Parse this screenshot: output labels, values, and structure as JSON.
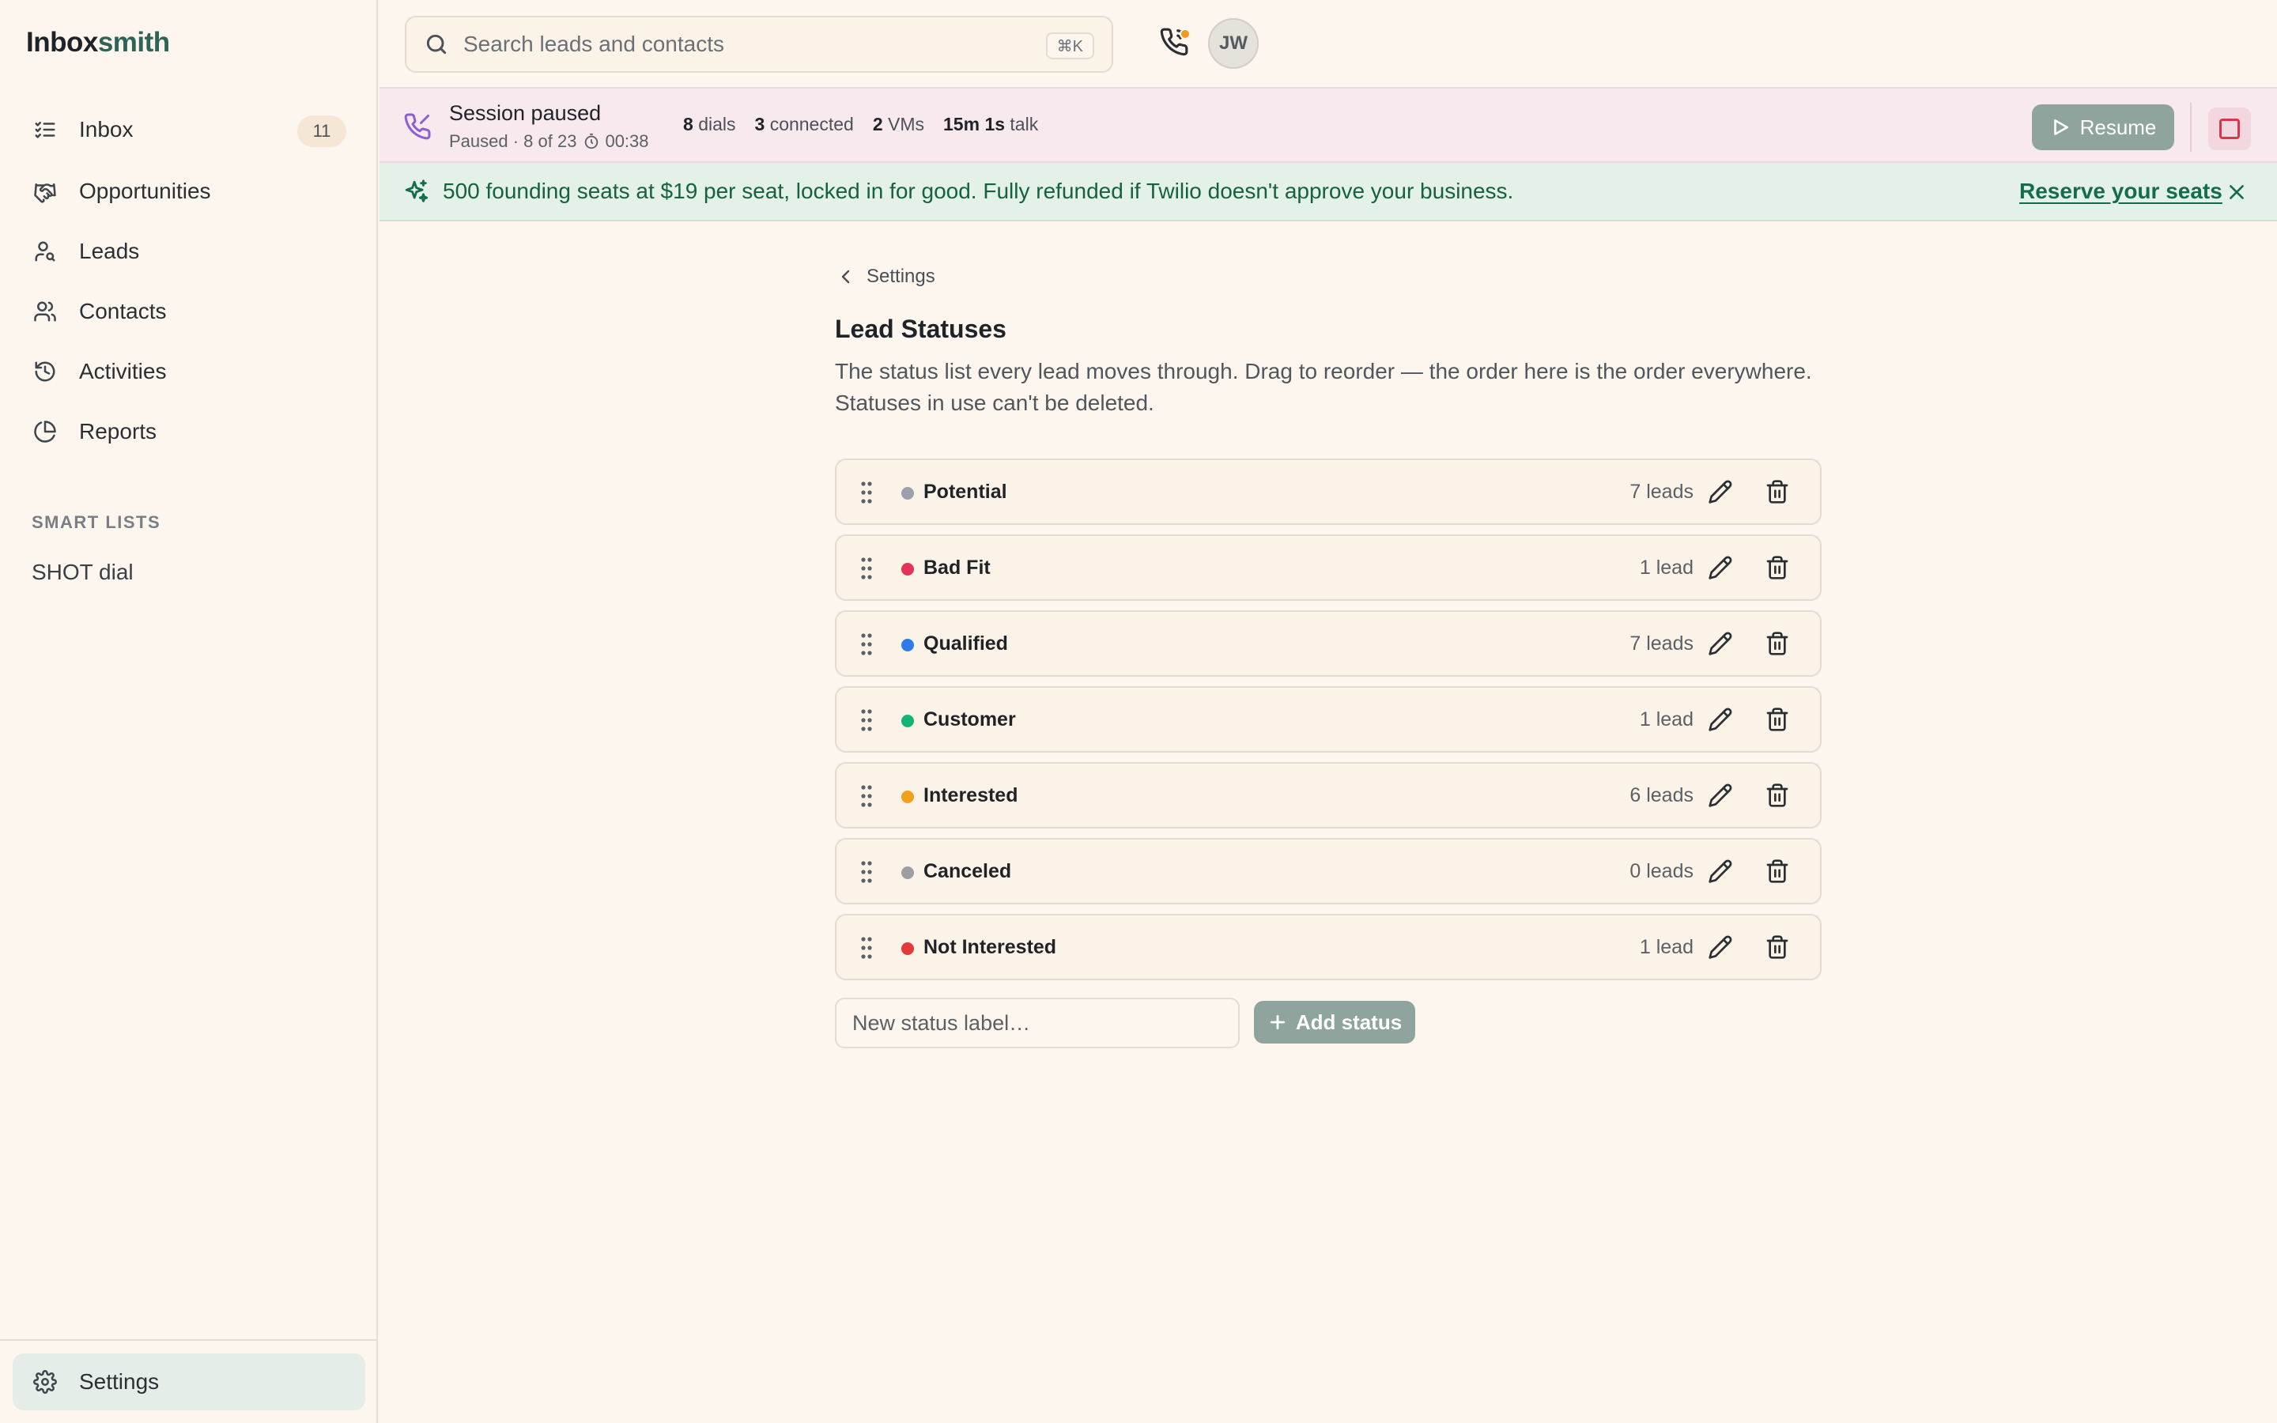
{
  "app": {
    "brand_part1": "Inbox",
    "brand_part2": "smith"
  },
  "sidebar": {
    "items": [
      {
        "label": "Inbox",
        "icon": "list-check-icon",
        "badge": "11"
      },
      {
        "label": "Opportunities",
        "icon": "handshake-icon"
      },
      {
        "label": "Leads",
        "icon": "user-search-icon"
      },
      {
        "label": "Contacts",
        "icon": "users-icon"
      },
      {
        "label": "Activities",
        "icon": "history-icon"
      },
      {
        "label": "Reports",
        "icon": "pie-chart-icon"
      }
    ],
    "section_label": "SMART LISTS",
    "smart_lists": [
      "SHOT dial"
    ],
    "settings_label": "Settings"
  },
  "topbar": {
    "search_placeholder": "Search leads and contacts",
    "search_shortcut": "⌘K",
    "avatar_initials": "JW",
    "notification_dot_color": "#f29a1f"
  },
  "session": {
    "title": "Session paused",
    "subtitle": "Paused · 8 of 23",
    "timer": "00:38",
    "stats": [
      {
        "value": "8",
        "label": "dials"
      },
      {
        "value": "3",
        "label": "connected"
      },
      {
        "value": "2",
        "label": "VMs"
      },
      {
        "value": "15m 1s",
        "label": "talk"
      }
    ],
    "resume_label": "Resume"
  },
  "promo": {
    "text": "500 founding seats at $19 per seat, locked in for good. Fully refunded if Twilio doesn't approve your business.",
    "link_label": "Reserve your seats"
  },
  "main": {
    "back_label": "Settings",
    "title": "Lead Statuses",
    "description": "The status list every lead moves through. Drag to reorder — the order here is the order everywhere. Statuses in use can't be deleted.",
    "statuses": [
      {
        "label": "Potential",
        "count": "7 leads",
        "color": "#9aa0ac"
      },
      {
        "label": "Bad Fit",
        "count": "1 lead",
        "color": "#e2335a"
      },
      {
        "label": "Qualified",
        "count": "7 leads",
        "color": "#2f7be8"
      },
      {
        "label": "Customer",
        "count": "1 lead",
        "color": "#15b377"
      },
      {
        "label": "Interested",
        "count": "6 leads",
        "color": "#f0a01a"
      },
      {
        "label": "Canceled",
        "count": "0 leads",
        "color": "#9b9ea4"
      },
      {
        "label": "Not Interested",
        "count": "1 lead",
        "color": "#e5383b"
      }
    ],
    "new_status_placeholder": "New status label…",
    "add_status_label": "Add status"
  }
}
